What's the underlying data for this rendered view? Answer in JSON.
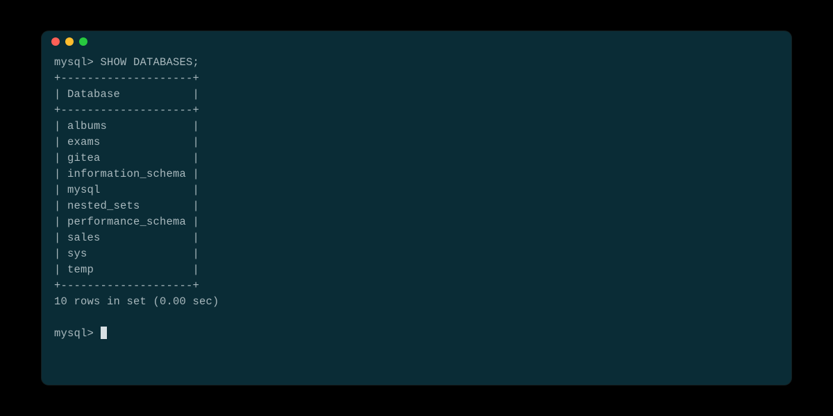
{
  "terminal": {
    "prompt": "mysql>",
    "command": "SHOW DATABASES;",
    "table": {
      "border_top": "+--------------------+",
      "header": "| Database           |",
      "border_mid": "+--------------------+",
      "rows": [
        "| albums             |",
        "| exams              |",
        "| gitea              |",
        "| information_schema |",
        "| mysql              |",
        "| nested_sets        |",
        "| performance_schema |",
        "| sales              |",
        "| sys                |",
        "| temp               |"
      ],
      "border_bot": "+--------------------+"
    },
    "result_summary": "10 rows in set (0.00 sec)",
    "databases": [
      "albums",
      "exams",
      "gitea",
      "information_schema",
      "mysql",
      "nested_sets",
      "performance_schema",
      "sales",
      "sys",
      "temp"
    ]
  }
}
